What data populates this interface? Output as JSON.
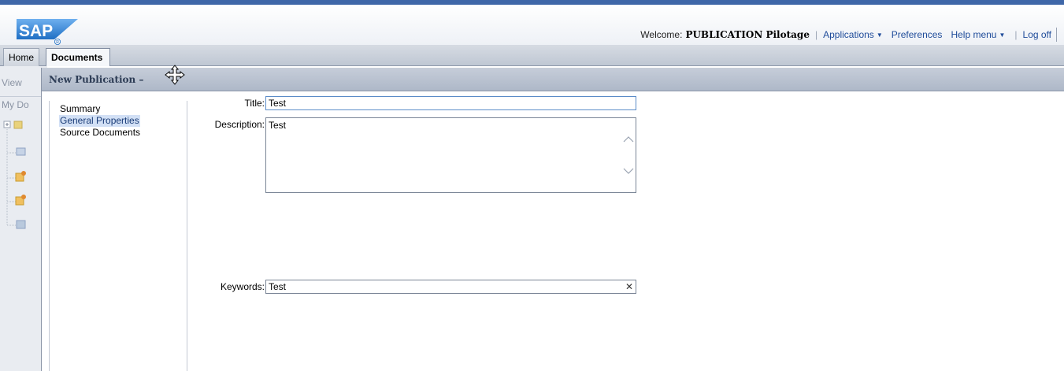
{
  "header": {
    "logo_text": "SAP",
    "welcome_label": "Welcome:",
    "user_name": "PUBLICATION Pilotage",
    "sep": "|",
    "links": {
      "applications": "Applications",
      "preferences": "Preferences",
      "help_menu": "Help menu",
      "log_off": "Log off"
    },
    "caret": "▼"
  },
  "tabs": {
    "home": "Home",
    "documents": "Documents"
  },
  "background": {
    "view_label": "View",
    "my_documents_label": "My Do"
  },
  "dialog": {
    "title": "New Publication –",
    "nav": {
      "items": [
        "Summary",
        "General Properties",
        "Source Documents"
      ],
      "selected": "General Properties"
    },
    "form": {
      "title_label": "Title:",
      "title_value": "Test",
      "description_label": "Description:",
      "description_value": "Test",
      "keywords_label": "Keywords:",
      "keywords_value": "Test",
      "clear_glyph": "✕"
    }
  },
  "colors": {
    "accent": "#3f67a8",
    "selection": "#d2e0f5",
    "link": "#1f4c9a"
  },
  "icons": [
    "sap-logo",
    "move-cursor-icon",
    "caret-down-icon",
    "clear-icon",
    "scroll-up-icon",
    "scroll-down-icon",
    "folder-icon",
    "user-folder-icon"
  ]
}
